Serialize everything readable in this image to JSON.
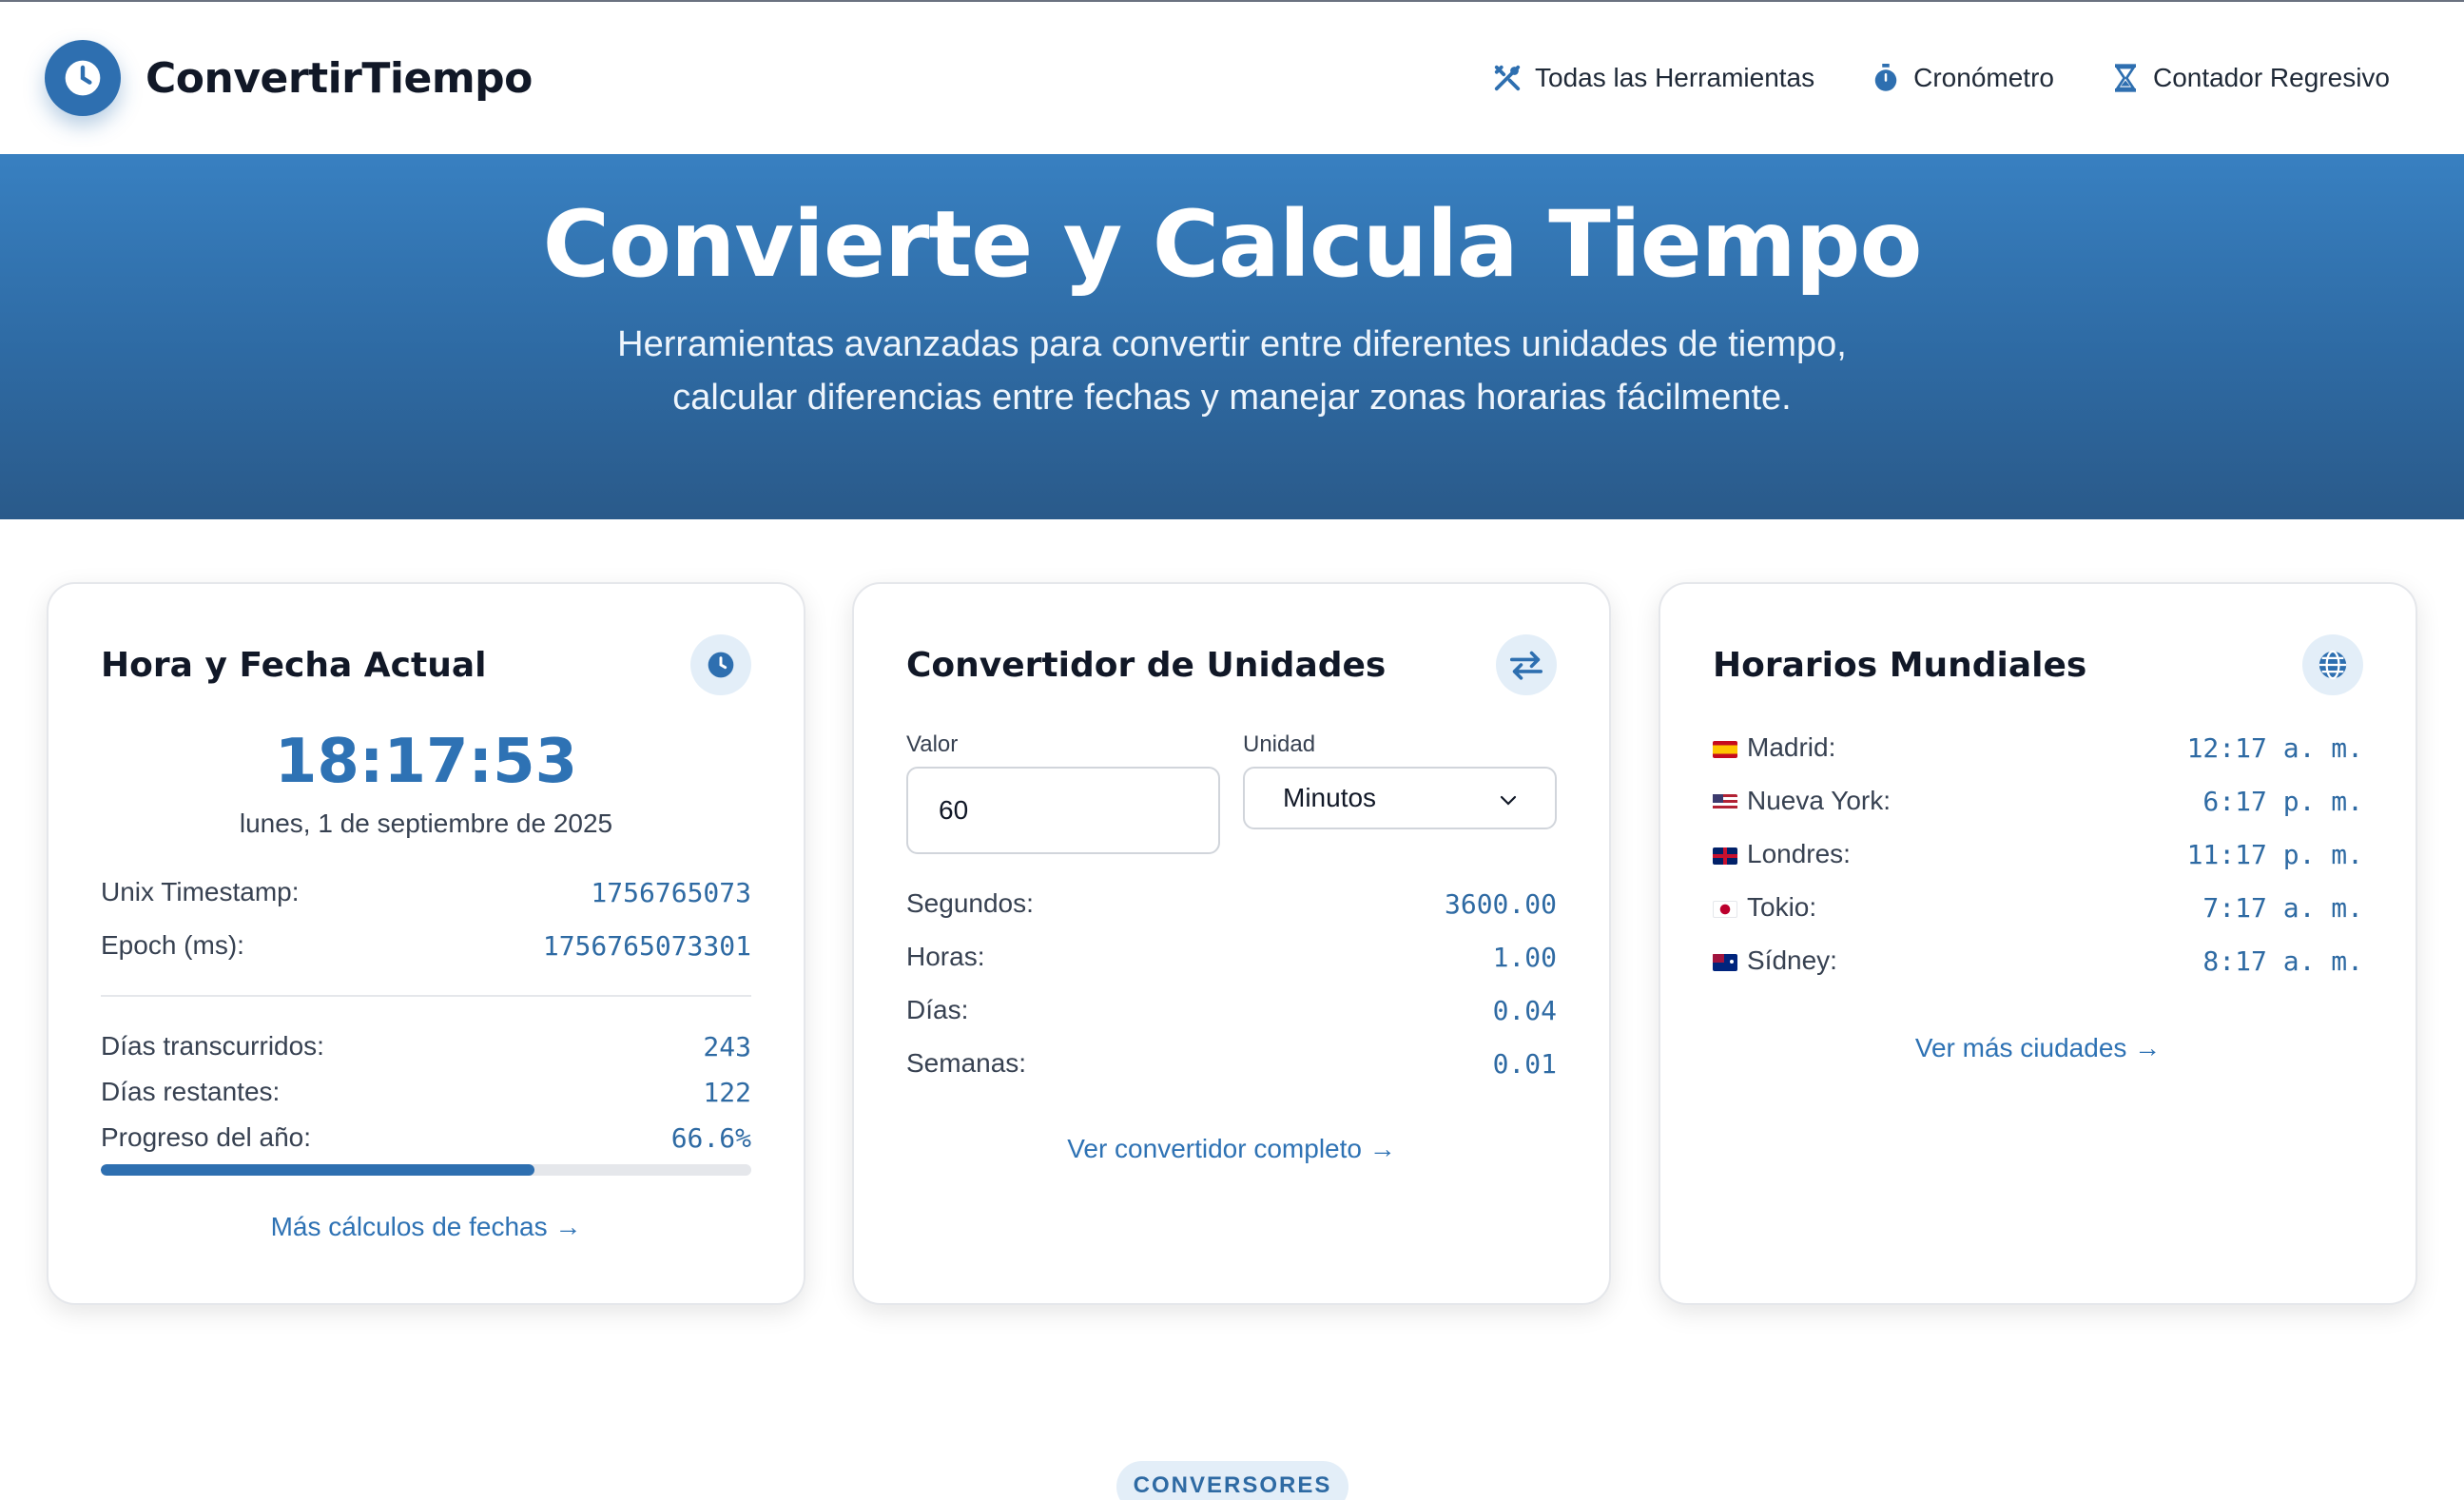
{
  "brand": {
    "name": "ConvertirTiempo"
  },
  "nav": [
    {
      "label": "Todas las Herramientas",
      "icon": "tools-icon"
    },
    {
      "label": "Cronómetro",
      "icon": "stopwatch-icon"
    },
    {
      "label": "Contador Regresivo",
      "icon": "hourglass-icon"
    }
  ],
  "hero": {
    "title": "Convierte y Calcula Tiempo",
    "subtitle_line1": "Herramientas avanzadas para convertir entre diferentes unidades de tiempo,",
    "subtitle_line2": "calcular diferencias entre fechas y manejar zonas horarias fácilmente."
  },
  "current": {
    "title": "Hora y Fecha Actual",
    "time": "18:17:53",
    "date": "lunes, 1 de septiembre de 2025",
    "unix_label": "Unix Timestamp:",
    "unix_value": "1756765073",
    "epoch_label": "Epoch (ms):",
    "epoch_value": "1756765073301",
    "elapsed_label": "Días transcurridos:",
    "elapsed_value": "243",
    "remaining_label": "Días restantes:",
    "remaining_value": "122",
    "progress_label": "Progreso del año:",
    "progress_value": "66.6%",
    "progress_fraction": 0.666,
    "link": "Más cálculos de fechas →"
  },
  "converter": {
    "title": "Convertidor de Unidades",
    "value_label": "Valor",
    "value": "60",
    "unit_label": "Unidad",
    "unit_selected": "Minutos",
    "results": [
      {
        "label": "Segundos:",
        "value": "3600.00"
      },
      {
        "label": "Horas:",
        "value": "1.00"
      },
      {
        "label": "Días:",
        "value": "0.04"
      },
      {
        "label": "Semanas:",
        "value": "0.01"
      }
    ],
    "link": "Ver convertidor completo →"
  },
  "world": {
    "title": "Horarios Mundiales",
    "cities": [
      {
        "name": "Madrid:",
        "time": "12:17 a. m.",
        "flag": "spain-flag"
      },
      {
        "name": "Nueva York:",
        "time": "6:17 p. m.",
        "flag": "usa-flag"
      },
      {
        "name": "Londres:",
        "time": "11:17 p. m.",
        "flag": "uk-flag"
      },
      {
        "name": "Tokio:",
        "time": "7:17 a. m.",
        "flag": "japan-flag"
      },
      {
        "name": "Sídney:",
        "time": "8:17 a. m.",
        "flag": "australia-flag"
      }
    ],
    "link": "Ver más ciudades →"
  },
  "section_badge": "CONVERSORES",
  "colors": {
    "accent": "#2e6fb0",
    "hero_top": "#3880c1",
    "hero_bottom": "#2a5a8a",
    "badge_bg": "#e3eef8"
  }
}
